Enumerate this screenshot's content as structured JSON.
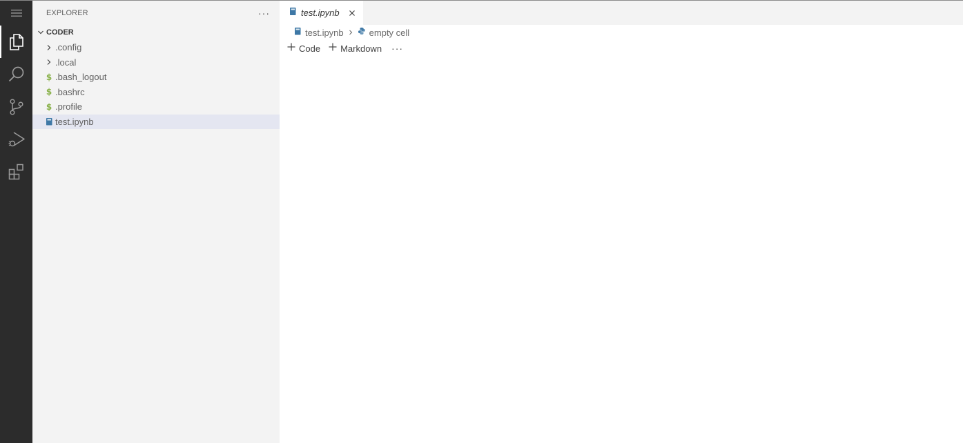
{
  "sidebar": {
    "title": "EXPLORER",
    "more_label": "···",
    "section_title": "CODER",
    "items": [
      {
        "label": ".config",
        "icon": "chevron-right-icon"
      },
      {
        "label": ".local",
        "icon": "chevron-right-icon"
      },
      {
        "label": ".bash_logout",
        "icon": "dollar-icon"
      },
      {
        "label": ".bashrc",
        "icon": "dollar-icon"
      },
      {
        "label": ".profile",
        "icon": "dollar-icon"
      },
      {
        "label": "test.ipynb",
        "icon": "notebook-icon",
        "selected": true
      }
    ],
    "dollar_glyph": "$"
  },
  "activity_bar": {
    "items": [
      "menu-icon",
      "explorer-icon",
      "search-icon",
      "source-control-icon",
      "run-debug-icon",
      "extensions-icon"
    ]
  },
  "editor": {
    "tab": {
      "label": "test.ipynb",
      "italic": true
    },
    "breadcrumb": {
      "file": "test.ipynb",
      "cell": "empty cell"
    },
    "toolbar": {
      "code_label": "Code",
      "markdown_label": "Markdown",
      "more_label": "···"
    }
  },
  "colors": {
    "activity_bar_bg": "#2c2c2c",
    "sidebar_bg": "#f3f3f3",
    "selected_bg": "#e4e6f1",
    "notebook_icon": "#3e78a6",
    "dollar_icon": "#89b14a"
  }
}
